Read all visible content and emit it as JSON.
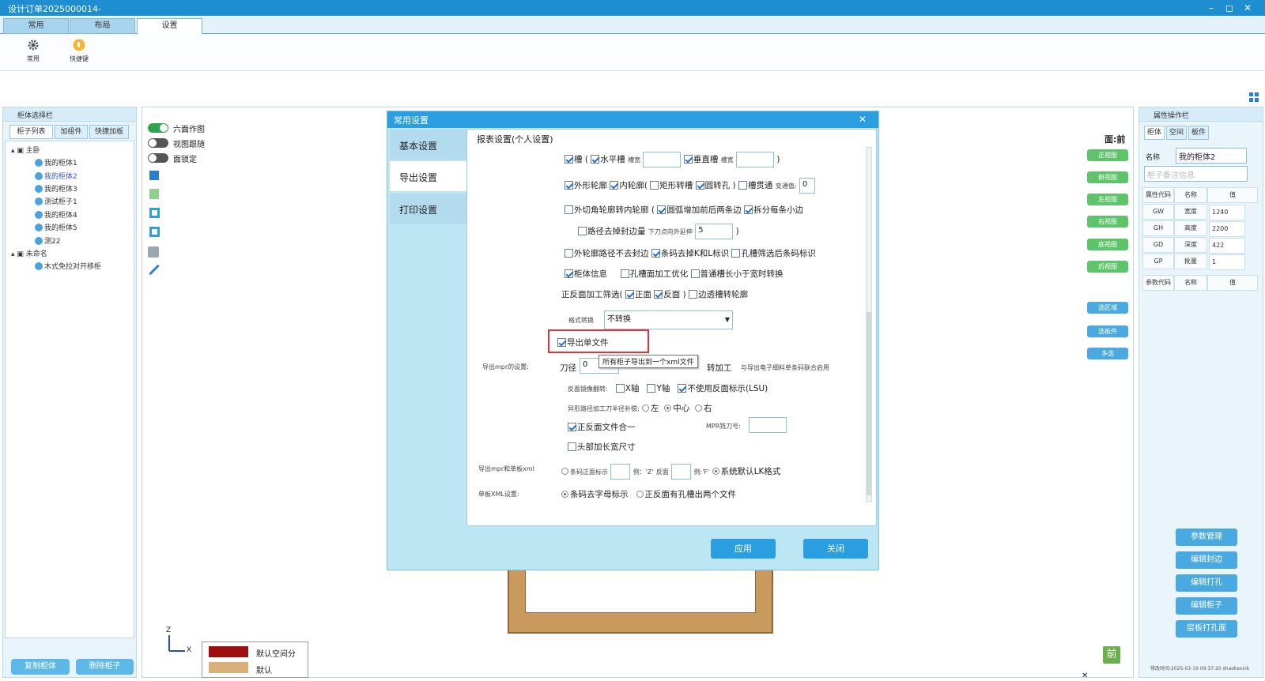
{
  "window": {
    "title": "设计订单2025000014-",
    "min": "–",
    "max": "◻",
    "close": "✕"
  },
  "ribbon": {
    "tabs": [
      "常用",
      "布局",
      "设置"
    ],
    "buttons": [
      "常用",
      "快捷键"
    ]
  },
  "left_panel": {
    "title": "柜体选择栏",
    "tabs": [
      "柜子列表",
      "加组件",
      "快捷加板"
    ],
    "tree": [
      {
        "label": "主卧",
        "group": true
      },
      {
        "label": "我的柜体1"
      },
      {
        "label": "我的柜体2",
        "selected": true
      },
      {
        "label": "我的柜体3"
      },
      {
        "label": "测试柜子1"
      },
      {
        "label": "我的柜体4"
      },
      {
        "label": "我的柜体5"
      },
      {
        "label": "测22"
      },
      {
        "label": "未命名",
        "group": true
      },
      {
        "label": "木式免拉对开移柜"
      }
    ],
    "copy_button": "复制柜体",
    "delete_button": "删除柜子"
  },
  "workspace": {
    "toggles": [
      {
        "label": "六面作图",
        "on": true
      },
      {
        "label": "视图跟随",
        "on": false
      },
      {
        "label": "面锁定",
        "on": false
      }
    ],
    "face_label": "面:前",
    "view_buttons": [
      "正视图",
      "俯视图",
      "左视图",
      "右视图",
      "底视图",
      "后视图"
    ],
    "select_buttons": [
      "选区域",
      "选板件",
      "多选"
    ],
    "legend": [
      {
        "label": "默认空间分",
        "color": "#9e1010"
      },
      {
        "label": "默认",
        "color": "#d9b07c"
      }
    ],
    "axis": {
      "z": "Z",
      "x": "X"
    },
    "front_badge": "前",
    "close_mark": "✕"
  },
  "right_panel": {
    "title": "属性操作栏",
    "tabs": [
      "柜体",
      "空间",
      "板件"
    ],
    "name_label": "名称",
    "name_value": "我的柜体2",
    "note_placeholder": "柜子备注信息",
    "attr_header": [
      "属性代码",
      "名称",
      "值"
    ],
    "attrs": [
      {
        "code": "GW",
        "name": "宽度",
        "value": "1240"
      },
      {
        "code": "GH",
        "name": "高度",
        "value": "2200"
      },
      {
        "code": "GD",
        "name": "深度",
        "value": "422"
      },
      {
        "code": "GP",
        "name": "批量",
        "value": "1"
      }
    ],
    "param_header": [
      "参数代码",
      "名称",
      "值"
    ],
    "actions": [
      "参数管理",
      "编辑封边",
      "编辑打孔",
      "编辑柜子",
      "层板打孔面"
    ],
    "footer": "修改时间:2025-03-19 09:37:20 shaokexink"
  },
  "dialog": {
    "title": "常用设置",
    "close": "✕",
    "nav": [
      "基本设置",
      "导出设置",
      "打印设置"
    ],
    "section": "报表设置(个人设置)",
    "row1": {
      "groove": "槽",
      "paren_open": "(",
      "h_groove": "水平槽",
      "slot_w": "槽宽",
      "v_groove": "垂直槽",
      "slot_w2": "槽宽",
      "paren_close": ")"
    },
    "row2": {
      "outer": "外形轮廓",
      "inner": "内轮廓",
      "rect": "矩形转槽",
      "round": "圆转孔",
      "paren": ")",
      "through": "槽贯通",
      "change_val": "变通值:",
      "value": "0",
      "paren_open": "("
    },
    "row3": {
      "text": "外切角轮廓转内轮廓",
      "paren_open": "(",
      "arc": "圆弧增加前后两条边",
      "split": "拆分每条小边"
    },
    "row4": {
      "path": "路径去掉封边量",
      "knife": "下刀点向外延伸",
      "value": "5",
      "paren": ")"
    },
    "row5": {
      "a": "外轮廓路径不去封边",
      "b": "条码去掉K和L标识",
      "c": "孔槽筛选后条码标识"
    },
    "row6": {
      "a": "柜体信息",
      "b": "孔槽面加工优化",
      "c": "普通槽长小于宽时转换"
    },
    "row7": {
      "a": "正反面加工筛选(",
      "b": "正面",
      "c": "反面",
      ")": ")",
      "d": "边透槽转轮廓"
    },
    "format": {
      "label": "格式转换",
      "value": "不转换"
    },
    "export_single": "导出单文件",
    "mpr": {
      "label": "导出mpr的设置:",
      "tool_label": "刀径",
      "tool_value": "0",
      "tooltip": "所有柜子导出到一个xml文件",
      "rotate": "转加工",
      "note": "与导出电子细料单条码联合启用"
    },
    "mirror": {
      "label": "反面镜像翻转:",
      "x": "X轴",
      "y": "Y轴",
      "lsu": "不使用反面标示(LSU)"
    },
    "comp": {
      "label": "异形路径加工刀半径补偿:",
      "left": "左",
      "center": "中心",
      "right": "右"
    },
    "merge": "正反面文件合一",
    "mpr_knife": "MPR铣刀号:",
    "head": "头部加长宽尺寸",
    "xml": {
      "label": "导出mpr和单板xml",
      "front": "条码正面标示",
      "eg1": "例：'Z'",
      "back": "反面",
      "eg2": "例:'F'",
      "default": "系统默认LK格式"
    },
    "single": {
      "label": "单板XML设置:",
      "a": "条码去字母标示",
      "b": "正反面有孔槽出两个文件"
    },
    "apply": "应用",
    "close_btn": "关闭"
  },
  "colors": {
    "accent": "#2a9ee0",
    "title": "#1e8ed0",
    "green": "#2ea44f",
    "highlight": "#e0343a"
  }
}
